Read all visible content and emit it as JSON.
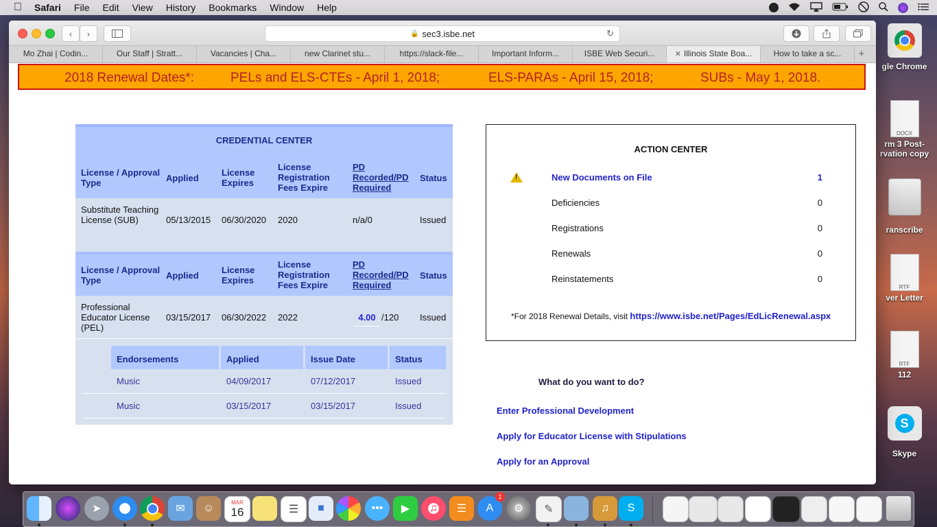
{
  "menubar": {
    "app": "Safari",
    "items": [
      "File",
      "Edit",
      "View",
      "History",
      "Bookmarks",
      "Window",
      "Help"
    ]
  },
  "desktop": {
    "items": [
      "gle Chrome",
      "DOCX",
      "rm 3 Post-",
      "rvation copy",
      "ranscribe",
      "RTF",
      "ver Letter",
      "RTF",
      "112",
      "Skype"
    ]
  },
  "browser": {
    "url": "sec3.isbe.net",
    "tabs": [
      "Mo Zhai | Codin...",
      "Our Staff | Stratt...",
      "Vacancies | Cha...",
      "new Clarinet stu...",
      "https://slack-file...",
      "Important Inform...",
      "ISBE Web Securi...",
      "Illinois State Boa...",
      "How to take a sc..."
    ],
    "active_tab_index": 7
  },
  "banner": {
    "label": "2018 Renewal Dates*:",
    "pels": "PELs and ELS-CTEs - April 1, 2018;",
    "paras": "ELS-PARAs - April 15, 2018;",
    "subs": "SUBs - May 1, 2018."
  },
  "credential_center": {
    "title": "CREDENTIAL CENTER",
    "headers": {
      "license_type": "License / Approval Type",
      "applied": "Applied",
      "expires": "License Expires",
      "reg_fees": "License Registration Fees Expire",
      "pd": "PD Recorded/PD Required",
      "status": "Status"
    },
    "licenses": [
      {
        "type": "Substitute Teaching License (SUB)",
        "applied": "05/13/2015",
        "expires": "06/30/2020",
        "fees_expire": "2020",
        "pd": "n/a/0",
        "status": "Issued"
      },
      {
        "type": "Professional Educator License (PEL)",
        "applied": "03/15/2017",
        "expires": "06/30/2022",
        "fees_expire": "2022",
        "pd_recorded": "4.00",
        "pd_required": "/120",
        "status": "Issued"
      }
    ],
    "endorsements": {
      "headers": {
        "endorsement": "Endorsements",
        "applied": "Applied",
        "issue_date": "Issue Date",
        "status": "Status"
      },
      "rows": [
        {
          "name": "Music",
          "applied": "04/09/2017",
          "issue_date": "07/12/2017",
          "status": "Issued"
        },
        {
          "name": "Music",
          "applied": "03/15/2017",
          "issue_date": "03/15/2017",
          "status": "Issued"
        }
      ]
    }
  },
  "action_center": {
    "title": "ACTION CENTER",
    "rows": [
      {
        "label": "New Documents on File",
        "value": "1"
      },
      {
        "label": "Deficiencies",
        "value": "0"
      },
      {
        "label": "Registrations",
        "value": "0"
      },
      {
        "label": "Renewals",
        "value": "0"
      },
      {
        "label": "Reinstatements",
        "value": "0"
      }
    ],
    "note_prefix": "*For 2018 Renewal Details, visit",
    "note_link": "https://www.isbe.net/Pages/EdLicRenewal.aspx"
  },
  "todo": {
    "title": "What do you want to do?",
    "links": [
      "Enter Professional Development",
      "Apply for Educator License with Stipulations",
      "Apply for an Approval"
    ]
  },
  "dock": {
    "calendar_month": "MAR",
    "calendar_day": "16",
    "appstore_badge": "1"
  }
}
